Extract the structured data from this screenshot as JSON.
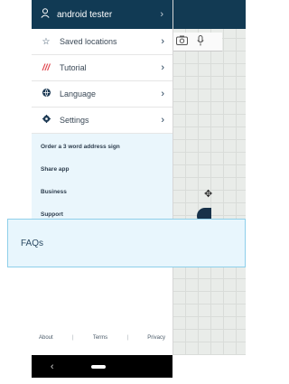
{
  "user": {
    "name": "android tester"
  },
  "menu": [
    {
      "label": "Saved locations",
      "icon": "star-icon"
    },
    {
      "label": "Tutorial",
      "icon": "slash-icon"
    },
    {
      "label": "Language",
      "icon": "globe-icon"
    },
    {
      "label": "Settings",
      "icon": "gear-icon"
    }
  ],
  "links": [
    "Order a 3 word address sign",
    "Share app",
    "Business",
    "Support"
  ],
  "highlight": {
    "label": "FAQs"
  },
  "footer": {
    "about": "About",
    "terms": "Terms",
    "privacy": "Privacy"
  },
  "colors": {
    "header": "#113a54",
    "accent": "#e0434b",
    "links_bg": "#eaf6fc"
  }
}
